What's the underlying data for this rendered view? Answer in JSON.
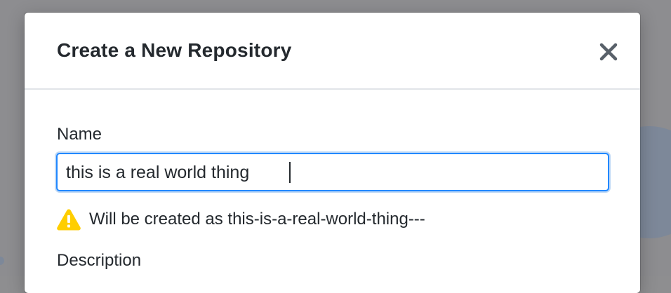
{
  "dialog": {
    "title": "Create a New Repository",
    "close_icon": "close-icon"
  },
  "form": {
    "name_label": "Name",
    "name_value": "this is a real world thing  ",
    "warning_icon": "warning-icon",
    "warning_text": "Will be created as this-is-a-real-world-thing---",
    "description_label": "Description"
  },
  "colors": {
    "focus_border": "#2188ff",
    "warning": "#ffce00",
    "text": "#24292e",
    "overlay": "#8d8d90"
  }
}
